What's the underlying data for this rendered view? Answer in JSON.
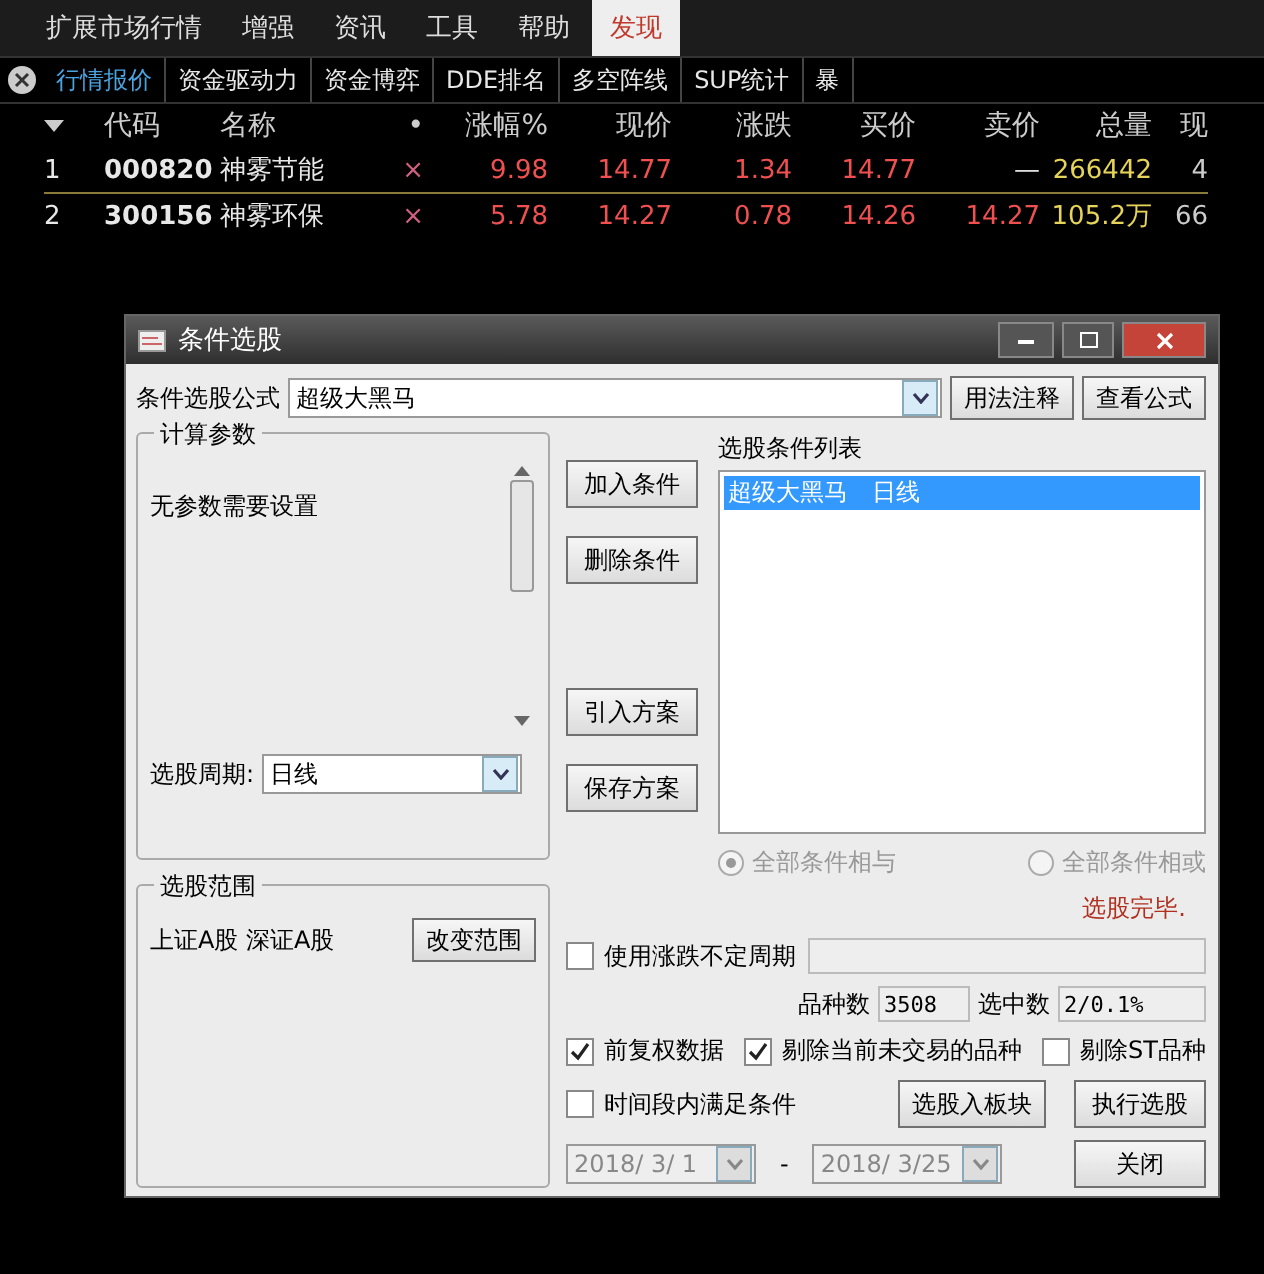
{
  "menu": [
    {
      "label": "扩展市场行情",
      "selected": false
    },
    {
      "label": "增强",
      "selected": false
    },
    {
      "label": "资讯",
      "selected": false
    },
    {
      "label": "工具",
      "selected": false
    },
    {
      "label": "帮助",
      "selected": false
    },
    {
      "label": "发现",
      "selected": true
    }
  ],
  "tabs": [
    {
      "label": "行情报价",
      "selected": true
    },
    {
      "label": "资金驱动力",
      "selected": false
    },
    {
      "label": "资金博弈",
      "selected": false
    },
    {
      "label": "DDE排名",
      "selected": false
    },
    {
      "label": "多空阵线",
      "selected": false
    },
    {
      "label": "SUP统计",
      "selected": false
    },
    {
      "label": "暴",
      "selected": false
    }
  ],
  "table": {
    "columns": [
      "代码",
      "名称",
      "•",
      "涨幅%",
      "现价",
      "涨跌",
      "买价",
      "卖价",
      "总量",
      "现"
    ],
    "rows": [
      {
        "index": "1",
        "cells": [
          "000820",
          "神雾节能",
          "×",
          "9.98",
          "14.77",
          "1.34",
          "14.77",
          "—",
          "266442",
          "4"
        ],
        "selected": true
      },
      {
        "index": "2",
        "cells": [
          "300156",
          "神雾环保",
          "×",
          "5.78",
          "14.27",
          "0.78",
          "14.26",
          "14.27",
          "105.2万",
          "66"
        ],
        "selected": false
      }
    ]
  },
  "dialog": {
    "title": "条件选股",
    "formula_label": "条件选股公式",
    "formula_value": "超级大黑马",
    "formula_buttons": [
      "用法注释",
      "查看公式"
    ],
    "params_group": {
      "title": "计算参数",
      "text": "无参数需要设置",
      "period_label": "选股周期:",
      "period_value": "日线"
    },
    "action_buttons": [
      "加入条件",
      "删除条件",
      "引入方案",
      "保存方案"
    ],
    "list_label": "选股条件列表",
    "list_items": [
      {
        "label": "超级大黑马　日线",
        "selected": true
      }
    ],
    "logic": [
      {
        "label": "全部条件相与",
        "selected": true
      },
      {
        "label": "全部条件相或",
        "selected": false
      }
    ],
    "status": "选股完毕.",
    "range_group": {
      "title": "选股范围",
      "text": "上证A股 深证A股",
      "button": "改变范围"
    },
    "variable_period": {
      "label": "使用涨跌不定周期",
      "checked": false
    },
    "count_label": "品种数",
    "count_value": "3508",
    "selected_label": "选中数",
    "selected_value": "2/0.1%",
    "options": [
      {
        "label": "前复权数据",
        "checked": true
      },
      {
        "label": "剔除当前未交易的品种",
        "checked": true
      },
      {
        "label": "剔除ST品种",
        "checked": false
      }
    ],
    "time_range": {
      "label": "时间段内满足条件",
      "checked": false,
      "start": "2018/ 3/ 1",
      "separator": "-",
      "end": "2018/ 3/25"
    },
    "bottom_buttons": [
      "选股入板块",
      "执行选股",
      "关闭"
    ]
  }
}
